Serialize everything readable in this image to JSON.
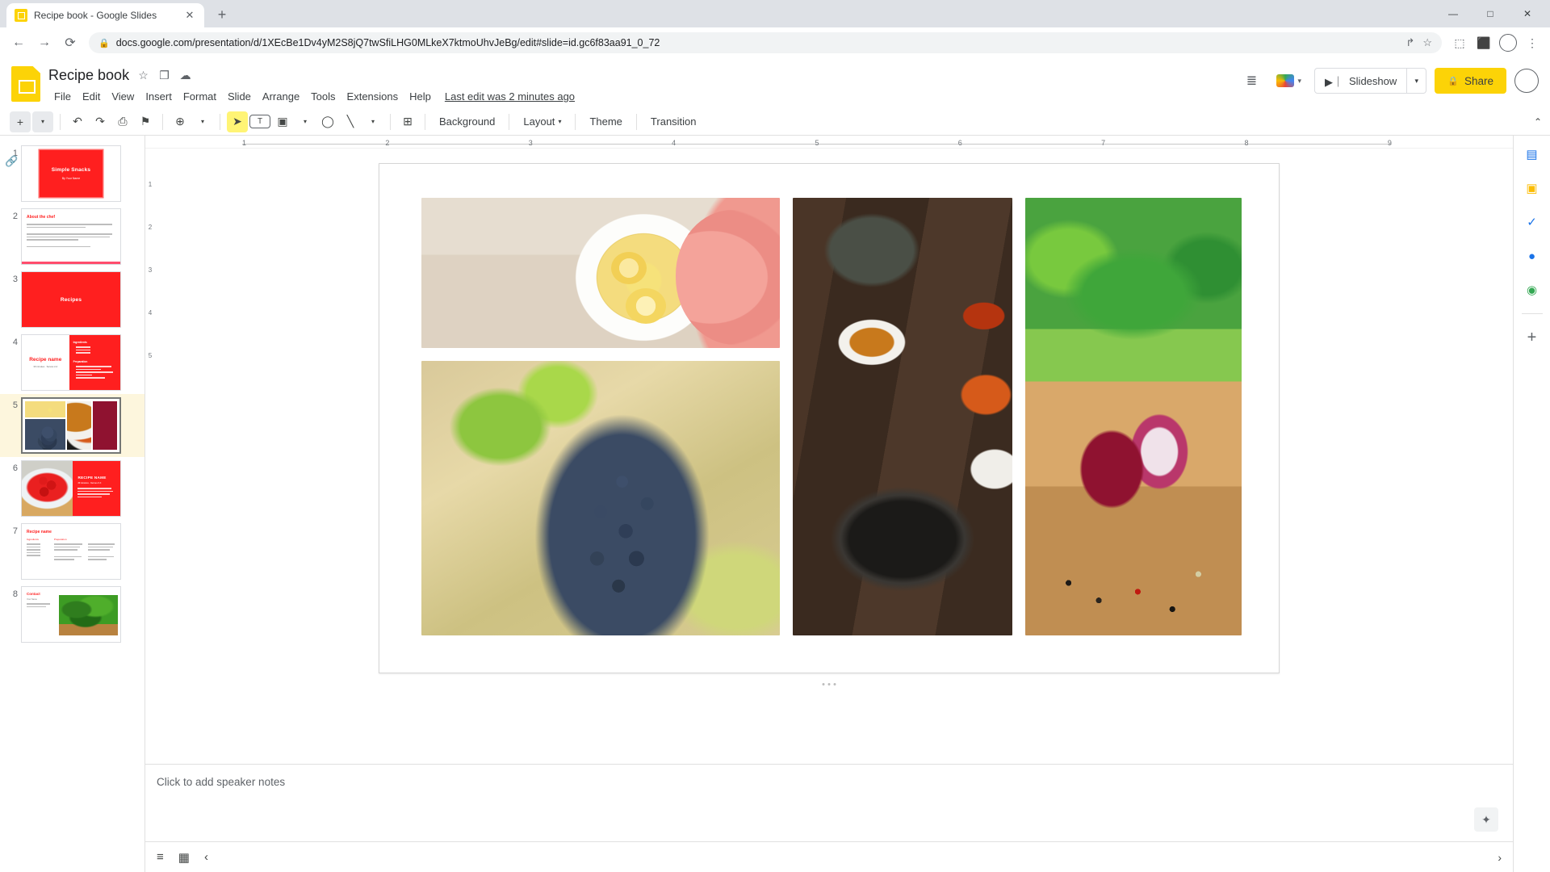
{
  "browser": {
    "tab": {
      "title": "Recipe book - Google Slides",
      "favicon": "slides-favicon",
      "close": "✕"
    },
    "new_tab": "+",
    "window_controls": {
      "minimize": "—",
      "maximize": "□",
      "close": "✕"
    },
    "nav": {
      "back": "←",
      "forward": "→",
      "reload": "⟳"
    },
    "omnibox": {
      "lock": "🔒",
      "url": "docs.google.com/presentation/d/1XEcBe1Dv4yM2S8jQ7twSfiLHG0MLkeX7ktmoUhvJeBg/edit#slide=id.gc6f83aa91_0_72",
      "share_icon": "↱",
      "bookmark_icon": "☆"
    },
    "toolbar_icons": {
      "extensions": "⬚",
      "profile": "○",
      "menu": "⋮",
      "sidepanel": "⬛"
    }
  },
  "docs": {
    "logo": "google-slides-logo",
    "title": "Recipe book",
    "title_icons": {
      "star": "☆",
      "move": "❐",
      "cloud": "☁"
    },
    "menus": [
      "File",
      "Edit",
      "View",
      "Insert",
      "Format",
      "Slide",
      "Arrange",
      "Tools",
      "Extensions",
      "Help"
    ],
    "last_edit": "Last edit was 2 minutes ago",
    "header_right": {
      "comment_history_icon": "≣",
      "meet_label": "▾",
      "slideshow_label": "Slideshow",
      "slideshow_caret": "▾",
      "share_label": "Share",
      "share_lock": "🔒"
    }
  },
  "toolbar": {
    "new_slide": "+",
    "new_slide_caret": "▾",
    "undo": "↶",
    "redo": "↷",
    "print": "⎙",
    "paint_format": "⚑",
    "zoom": "⊕",
    "zoom_caret": "▾",
    "select": "➤",
    "textbox": "T",
    "image": "▣",
    "image_caret": "▾",
    "shape": "◯",
    "line": "╲",
    "line_caret": "▾",
    "comment": "⊞",
    "background": "Background",
    "layout": "Layout",
    "layout_caret": "▾",
    "theme": "Theme",
    "transition": "Transition",
    "collapse": "⌃"
  },
  "filmstrip": {
    "link_icon": "🔗",
    "slides": [
      {
        "number": "1",
        "kind": "title-card",
        "title": "Simple Snacks",
        "subtitle": "By Your Name",
        "selected": false
      },
      {
        "number": "2",
        "kind": "text-page",
        "title": "About the chef",
        "selected": false
      },
      {
        "number": "3",
        "kind": "section-red",
        "title": "Recipes",
        "selected": false
      },
      {
        "number": "4",
        "kind": "recipe-split",
        "title": "Recipe name",
        "subtitle": "30 minutes · Serves 2-4",
        "side_title": "Ingredients",
        "side_title2": "Preparation",
        "selected": false
      },
      {
        "number": "5",
        "kind": "photo-collage",
        "title": "",
        "selected": true
      },
      {
        "number": "6",
        "kind": "photo-red-panel",
        "title": "RECIPE NAME",
        "subtitle": "30 minutes · Serves 2-4",
        "selected": false
      },
      {
        "number": "7",
        "kind": "two-col-text",
        "title": "Recipe name",
        "col1": "Ingredients",
        "col2": "Preparation",
        "selected": false
      },
      {
        "number": "8",
        "kind": "contact",
        "title": "Contact",
        "subtitle": "Your Name",
        "selected": false
      }
    ]
  },
  "ruler": {
    "horizontal": [
      "1",
      "2",
      "3",
      "4",
      "5",
      "6",
      "7",
      "8",
      "9"
    ],
    "vertical": [
      "1",
      "2",
      "3",
      "4",
      "5"
    ]
  },
  "canvas": {
    "slide_number": "5",
    "photos": [
      {
        "name": "photo-lemon-ginger-tea",
        "alt": "Bowl of lemon ginger tea held by hands"
      },
      {
        "name": "photo-grapes-vine",
        "alt": "Dark blue grapes on the vine with green leaves"
      },
      {
        "name": "photo-mortar-pestle-spices",
        "alt": "Mortar and pestle with spice bowls on dark wood"
      },
      {
        "name": "photo-red-onion-peppercorns",
        "alt": "Halved red onion with peppercorns and herbs"
      }
    ]
  },
  "notes": {
    "placeholder": "Click to add speaker notes",
    "explore_icon": "✦"
  },
  "bottom_bar": {
    "filmstrip_view_icon": "≡",
    "grid_view_icon": "▦",
    "collapse_icon": "‹",
    "expand_icon": "›"
  },
  "side_rail": {
    "items": [
      {
        "name": "google-calendar-icon",
        "glyph": "▤",
        "color": "#1a73e8"
      },
      {
        "name": "google-keep-icon",
        "glyph": "▣",
        "color": "#fbbc04"
      },
      {
        "name": "google-tasks-icon",
        "glyph": "✓",
        "color": "#1a73e8"
      },
      {
        "name": "google-contacts-icon",
        "glyph": "●",
        "color": "#1a73e8"
      },
      {
        "name": "google-maps-icon",
        "glyph": "◉",
        "color": "#34a853"
      },
      {
        "name": "add-ons-icon",
        "glyph": "+",
        "color": "#5f6368"
      }
    ]
  },
  "colors": {
    "brand_yellow": "#fcd307",
    "theme_red": "#ff1f1f",
    "chrome_tabstrip": "#dee1e6",
    "selected_slide_bg": "#fdf6dd",
    "active_tool_bg": "#fff475"
  }
}
